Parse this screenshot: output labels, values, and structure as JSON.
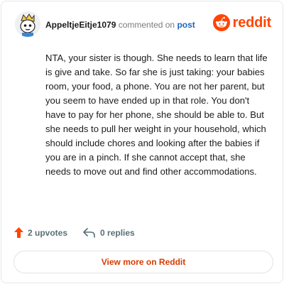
{
  "header": {
    "username": "AppeltjeEitje1079",
    "action_text": "commented on",
    "post_link": "post"
  },
  "brand": {
    "wordmark": "reddit",
    "icon": "reddit-snoo-icon",
    "color": "#ff4500"
  },
  "comment": {
    "text": "NTA, your sister is though. She needs to learn that life is give and take. So far she is just taking: your babies room, your food, a phone. You are not her parent, but you seem to have ended up in that role. You don't have to pay for her phone, she should be able to. But she needs to pull her weight in your household, which should include chores and looking after the babies if you are in a pinch. If she cannot accept that, she needs to move out and find other accommodations."
  },
  "footer": {
    "upvotes": "2 upvotes",
    "replies": "0 replies",
    "upvote_icon": "upvote-arrow-icon",
    "reply_icon": "reply-arrow-icon",
    "upvote_color": "#ff4500"
  },
  "cta": {
    "label": "View more on Reddit",
    "color": "#d93a00"
  }
}
